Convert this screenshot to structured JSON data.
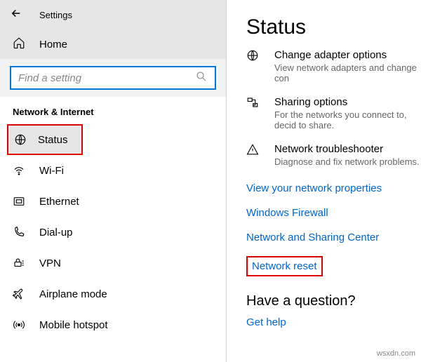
{
  "topbar": {
    "title": "Settings"
  },
  "home": {
    "label": "Home"
  },
  "search": {
    "placeholder": "Find a setting"
  },
  "section": {
    "header": "Network & Internet"
  },
  "nav": {
    "items": [
      {
        "label": "Status"
      },
      {
        "label": "Wi-Fi"
      },
      {
        "label": "Ethernet"
      },
      {
        "label": "Dial-up"
      },
      {
        "label": "VPN"
      },
      {
        "label": "Airplane mode"
      },
      {
        "label": "Mobile hotspot"
      }
    ]
  },
  "main": {
    "title": "Status",
    "options": [
      {
        "title": "Change adapter options",
        "desc": "View network adapters and change con"
      },
      {
        "title": "Sharing options",
        "desc": "For the networks you connect to, decid to share."
      },
      {
        "title": "Network troubleshooter",
        "desc": "Diagnose and fix network problems."
      }
    ],
    "links": [
      "View your network properties",
      "Windows Firewall",
      "Network and Sharing Center",
      "Network reset"
    ],
    "question": {
      "title": "Have a question?",
      "link": "Get help"
    }
  },
  "watermark": "wsxdn.com"
}
